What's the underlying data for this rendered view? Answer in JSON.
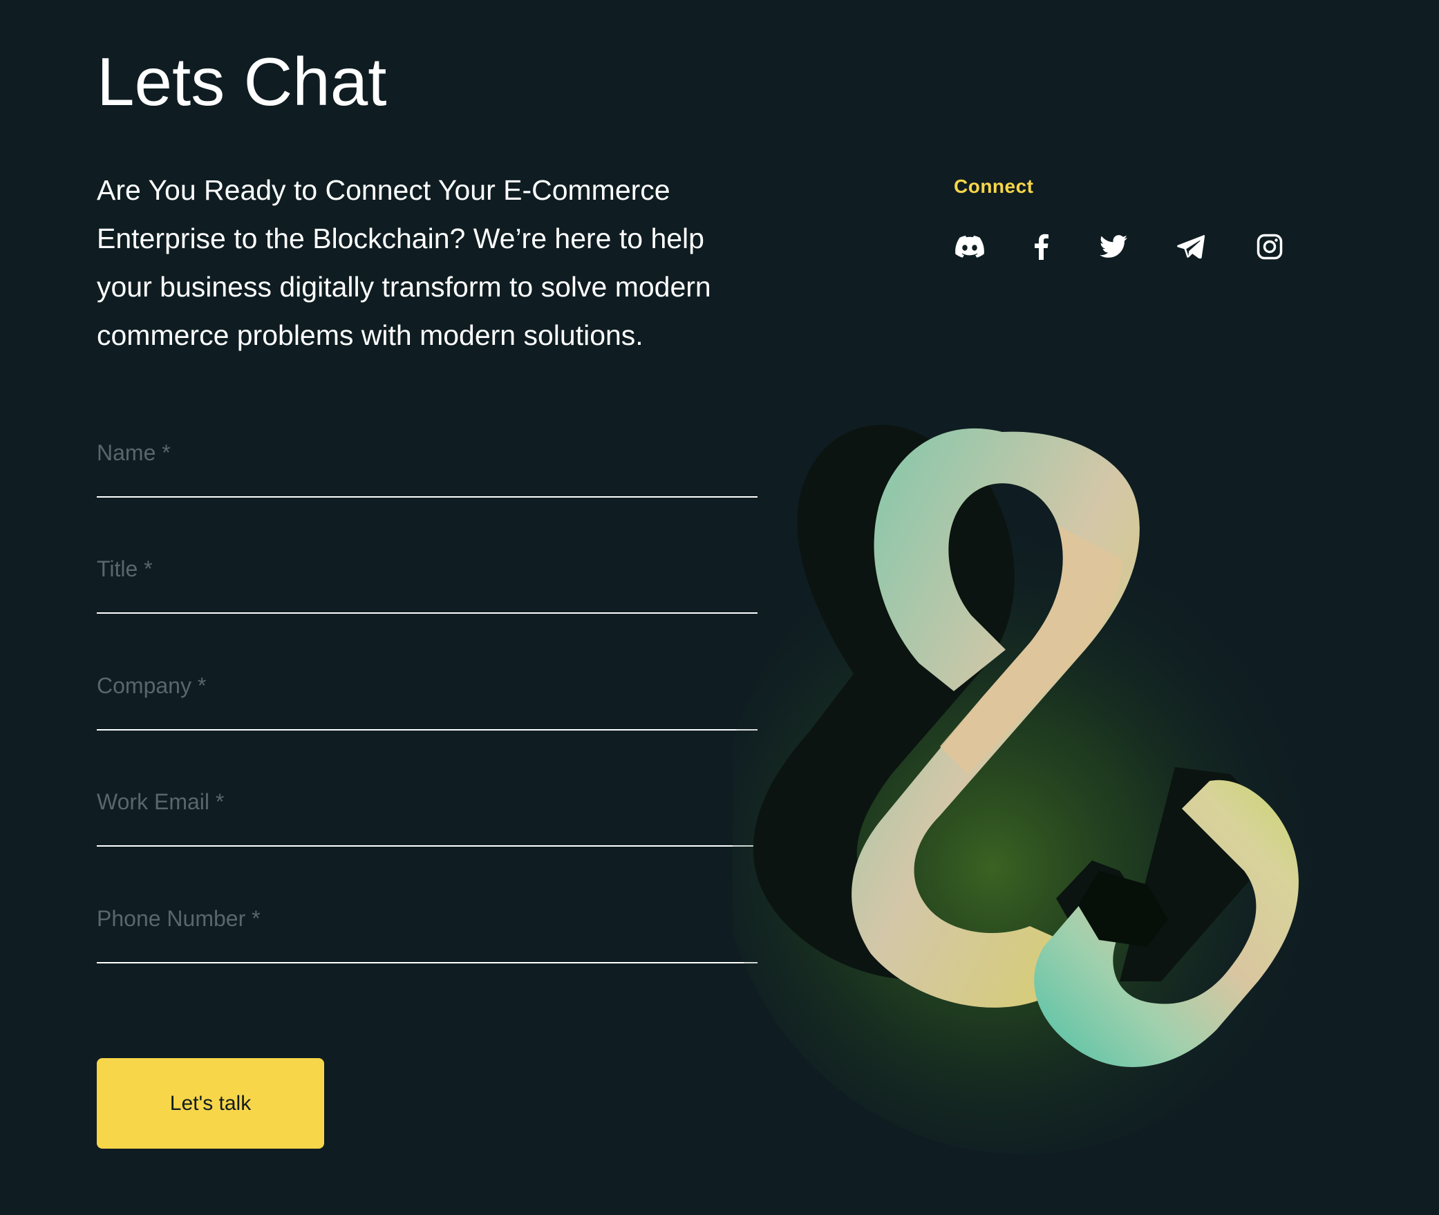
{
  "page": {
    "title": "Lets Chat",
    "intro": "Are You Ready to Connect Your E-Commerce Enterprise to the Blockchain? We’re here to help your business digitally transform to solve modern commerce problems with modern solutions."
  },
  "form": {
    "fields": [
      {
        "placeholder": "Name *",
        "value": ""
      },
      {
        "placeholder": "Title *",
        "value": ""
      },
      {
        "placeholder": "Company *",
        "value": ""
      },
      {
        "placeholder": "Work Email *",
        "value": ""
      },
      {
        "placeholder": "Phone Number *",
        "value": ""
      }
    ],
    "submit_label": "Let's talk"
  },
  "connect": {
    "label": "Connect",
    "icons": [
      "discord-icon",
      "facebook-icon",
      "twitter-icon",
      "telegram-icon",
      "instagram-icon"
    ]
  },
  "colors": {
    "background": "#0f1d22",
    "accent": "#f8d64a",
    "text": "#ffffff",
    "placeholder": "#58676b"
  }
}
